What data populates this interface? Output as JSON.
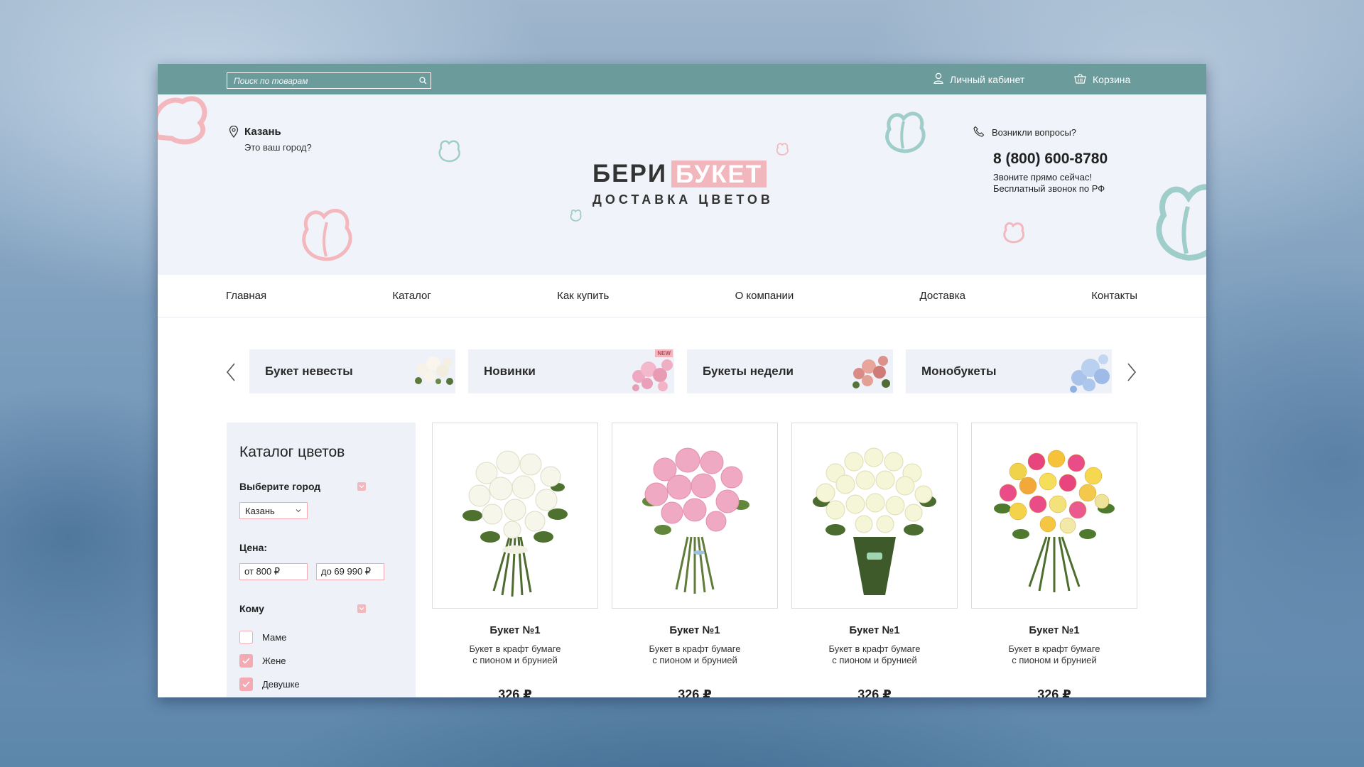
{
  "topbar": {
    "search_placeholder": "Поиск по товарам",
    "account_label": "Личный кабинет",
    "cart_label": "Корзина"
  },
  "hero": {
    "city_name": "Казань",
    "city_question": "Это ваш город?",
    "logo_word1": "БЕРИ",
    "logo_word2": "БУКЕТ",
    "logo_tagline": "ДОСТАВКА ЦВЕТОВ",
    "questions_label": "Возникли вопросы?",
    "phone": "8 (800) 600-8780",
    "call_now": "Звоните прямо сейчас!",
    "free_call": "Бесплатный звонок по РФ"
  },
  "nav": {
    "items": [
      "Главная",
      "Каталог",
      "Как купить",
      "О компании",
      "Доставка",
      "Контакты"
    ]
  },
  "categories": [
    {
      "label": "Букет невесты",
      "badge": ""
    },
    {
      "label": "Новинки",
      "badge": "NEW"
    },
    {
      "label": "Букеты недели",
      "badge": ""
    },
    {
      "label": "Монобукеты",
      "badge": ""
    }
  ],
  "catalog": {
    "title": "Каталог цветов",
    "city_filter_label": "Выберите город",
    "city_selected": "Казань",
    "price_label": "Цена:",
    "price_from": "от 800 ₽",
    "price_to": "до 69 990 ₽",
    "recipient_label": "Кому",
    "recipients": [
      {
        "label": "Маме",
        "checked": false
      },
      {
        "label": "Жене",
        "checked": true
      },
      {
        "label": "Девушке",
        "checked": true
      }
    ]
  },
  "products": [
    {
      "name": "Букет №1",
      "desc1": "Букет в крафт бумаге",
      "desc2": "с пионом и брунией",
      "price": "326 ₽"
    },
    {
      "name": "Букет №1",
      "desc1": "Букет в крафт бумаге",
      "desc2": "с пионом и брунией",
      "price": "326 ₽"
    },
    {
      "name": "Букет №1",
      "desc1": "Букет в крафт бумаге",
      "desc2": "с пионом и брунией",
      "price": "326 ₽"
    },
    {
      "name": "Букет №1",
      "desc1": "Букет в крафт бумаге",
      "desc2": "с пионом и брунией",
      "price": "326 ₽"
    }
  ],
  "colors": {
    "topbar": "#6b9b9b",
    "accent_pink": "#f3aab3",
    "hero_bg": "#f0f3f9"
  },
  "icons": {
    "search": "search-icon",
    "account": "user-icon",
    "cart": "basket-icon",
    "location": "pin-icon",
    "phone": "phone-icon"
  }
}
